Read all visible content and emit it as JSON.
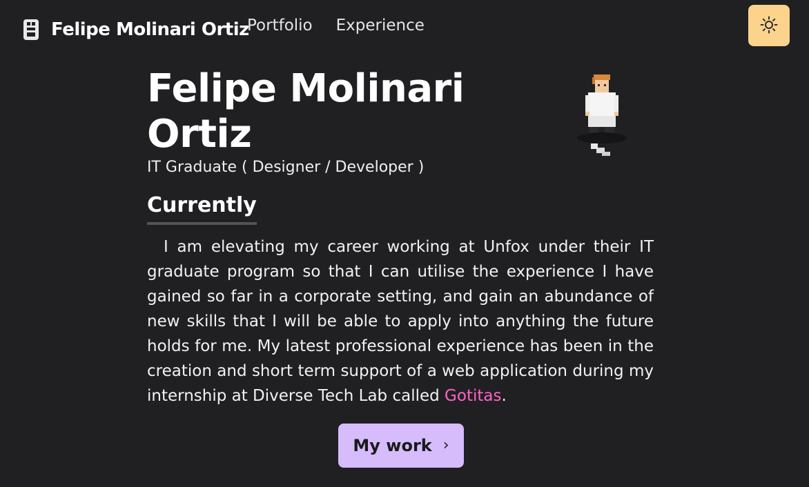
{
  "nav": {
    "brand_icon": "footprint-icon",
    "brand_name": "Felipe Molinari Ortiz",
    "links": [
      {
        "label": "Portfolio"
      },
      {
        "label": "Experience"
      }
    ],
    "theme_toggle_icon": "sun-icon"
  },
  "hero": {
    "title_line1": "Felipe Molinari",
    "title_line2": "Ortiz",
    "subtitle": "IT Graduate ( Designer / Developer )",
    "avatar_icon": "pixel-character-avatar"
  },
  "section": {
    "heading": "Currently",
    "body": "I am elevating my career working at Unfox under their IT graduate program so that I can utilise the experience I have gained so far in a corporate setting, and gain an abundance of new skills that I will be able to apply into anything the future holds for me. My latest professional experience has been in the creation and short term support of a web application during my internship at Diverse Tech Lab called ",
    "link_label": "Gotitas",
    "body_end": "."
  },
  "cta": {
    "label": "My work",
    "icon": "chevron-right-icon"
  },
  "colors": {
    "background": "#202023",
    "accent_toggle": "#fbd38d",
    "accent_button": "#d6bcfa",
    "link": "#ff63c3"
  }
}
